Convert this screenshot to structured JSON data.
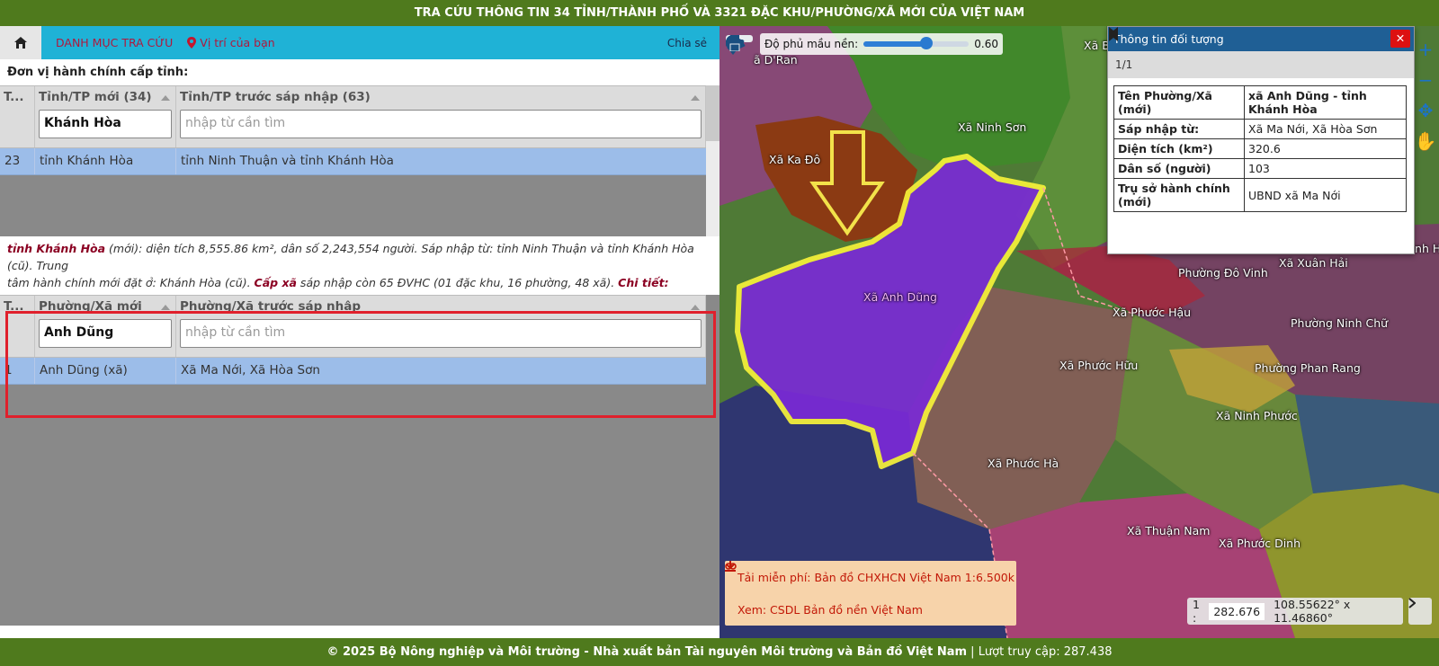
{
  "header": {
    "title": "TRA CỨU THÔNG TIN 34 TỈNH/THÀNH PHỐ VÀ 3321 ĐẶC KHU/PHƯỜNG/XÃ MỚI CỦA VIỆT NAM"
  },
  "nav": {
    "home_icon": "home-icon",
    "catalog": "DANH MỤC TRA CỨU",
    "location": "Vị trí của bạn",
    "share": "Chia sẻ"
  },
  "province": {
    "section_title": "Đơn vị hành chính cấp tỉnh:",
    "col_index": "T...",
    "col_new": "Tỉnh/TP mới (34)",
    "col_old": "Tỉnh/TP trước sáp nhập (63)",
    "filter_new": "Khánh Hòa",
    "filter_old_placeholder": "nhập từ cần tìm",
    "rows": [
      {
        "index": "23",
        "new": "tỉnh Khánh Hòa",
        "old": "tỉnh Ninh Thuận và tỉnh Khánh Hòa"
      }
    ]
  },
  "info": {
    "name": "tỉnh Khánh Hòa",
    "line1": " (mới): diện tích 8,555.86 km², dân số 2,243,554 người. Sáp nhập từ: tỉnh Ninh Thuận và tỉnh Khánh Hòa (cũ). Trung",
    "line2": "tâm hành chính mới đặt ở: Khánh Hòa (cũ). ",
    "cap_xa": "Cấp xã",
    "line3": " sáp nhập còn 65 ĐVHC (01 đặc khu, 16 phường, 48 xã). ",
    "chi_tiet": "Chi tiết:"
  },
  "commune": {
    "col_index": "T...",
    "col_new": "Phường/Xã mới",
    "col_old": "Phường/Xã trước sáp nhập",
    "filter_new": "Anh Dũng",
    "filter_old_placeholder": "nhập từ cần tìm",
    "rows": [
      {
        "index": "1",
        "new": "Anh Dũng (xã)",
        "old": "Xã Ma Nới, Xã Hòa Sơn"
      }
    ]
  },
  "map": {
    "opacity_label": "Độ phủ mầu nền:",
    "opacity_value": "0.60",
    "opacity_fraction": 0.6,
    "labels": {
      "dran": "ã D'Ran",
      "ninh_son": "Xã Ninh Sơn",
      "ka_do": "Xã Ka Đô",
      "anh_dung": "Xã Anh Dũng",
      "bac": "Xã Bác",
      "ninh_h": "Xã Ninh H",
      "xuan_hai": "Xã Xuân Hải",
      "do_vinh": "Phường Đô Vinh",
      "phuoc_hau": "Xã Phước Hậu",
      "ninh_chu": "Phường Ninh Chữ",
      "phuoc_huu": "Xã Phước Hữu",
      "phan_rang": "Phường Phan Rang",
      "ninh_phuoc": "Xã Ninh Phước",
      "phuoc_ha": "Xã Phước Hà",
      "thuan_nam": "Xã Thuận Nam",
      "phuoc_dinh": "Xã Phước Dinh"
    },
    "popup": {
      "title": "Thông tin đối tượng",
      "close": "✕",
      "pager": "1/1",
      "rows": [
        {
          "key": "Tên Phường/Xã (mới)",
          "value": "xã Anh Dũng - tỉnh Khánh Hòa"
        },
        {
          "key": "Sáp nhập từ:",
          "value": "Xã Ma Nới, Xã Hòa Sơn"
        },
        {
          "key": "Diện tích (km²)",
          "value": "320.6"
        },
        {
          "key": "Dân số (người)",
          "value": "103"
        },
        {
          "key": "Trụ sở hành chính (mới)",
          "value": "UBND xã Ma Nới"
        }
      ]
    },
    "download": {
      "free": "Tải miễn phí: Bản đồ CHXHCN Việt Nam 1:6.500k",
      "view": "Xem: CSDL Bản đồ nền Việt Nam"
    },
    "scale": {
      "prefix": "1 :",
      "value": "282.676",
      "coords": "108.55622° x 11.46860°"
    }
  },
  "footer": {
    "copyright": "© 2025  Bộ Nông nghiệp và Môi trường - Nhà xuất bản Tài nguyên Môi trường và Bản đồ Việt Nam",
    "visits": " | Lượt truy cập: 287.438"
  }
}
